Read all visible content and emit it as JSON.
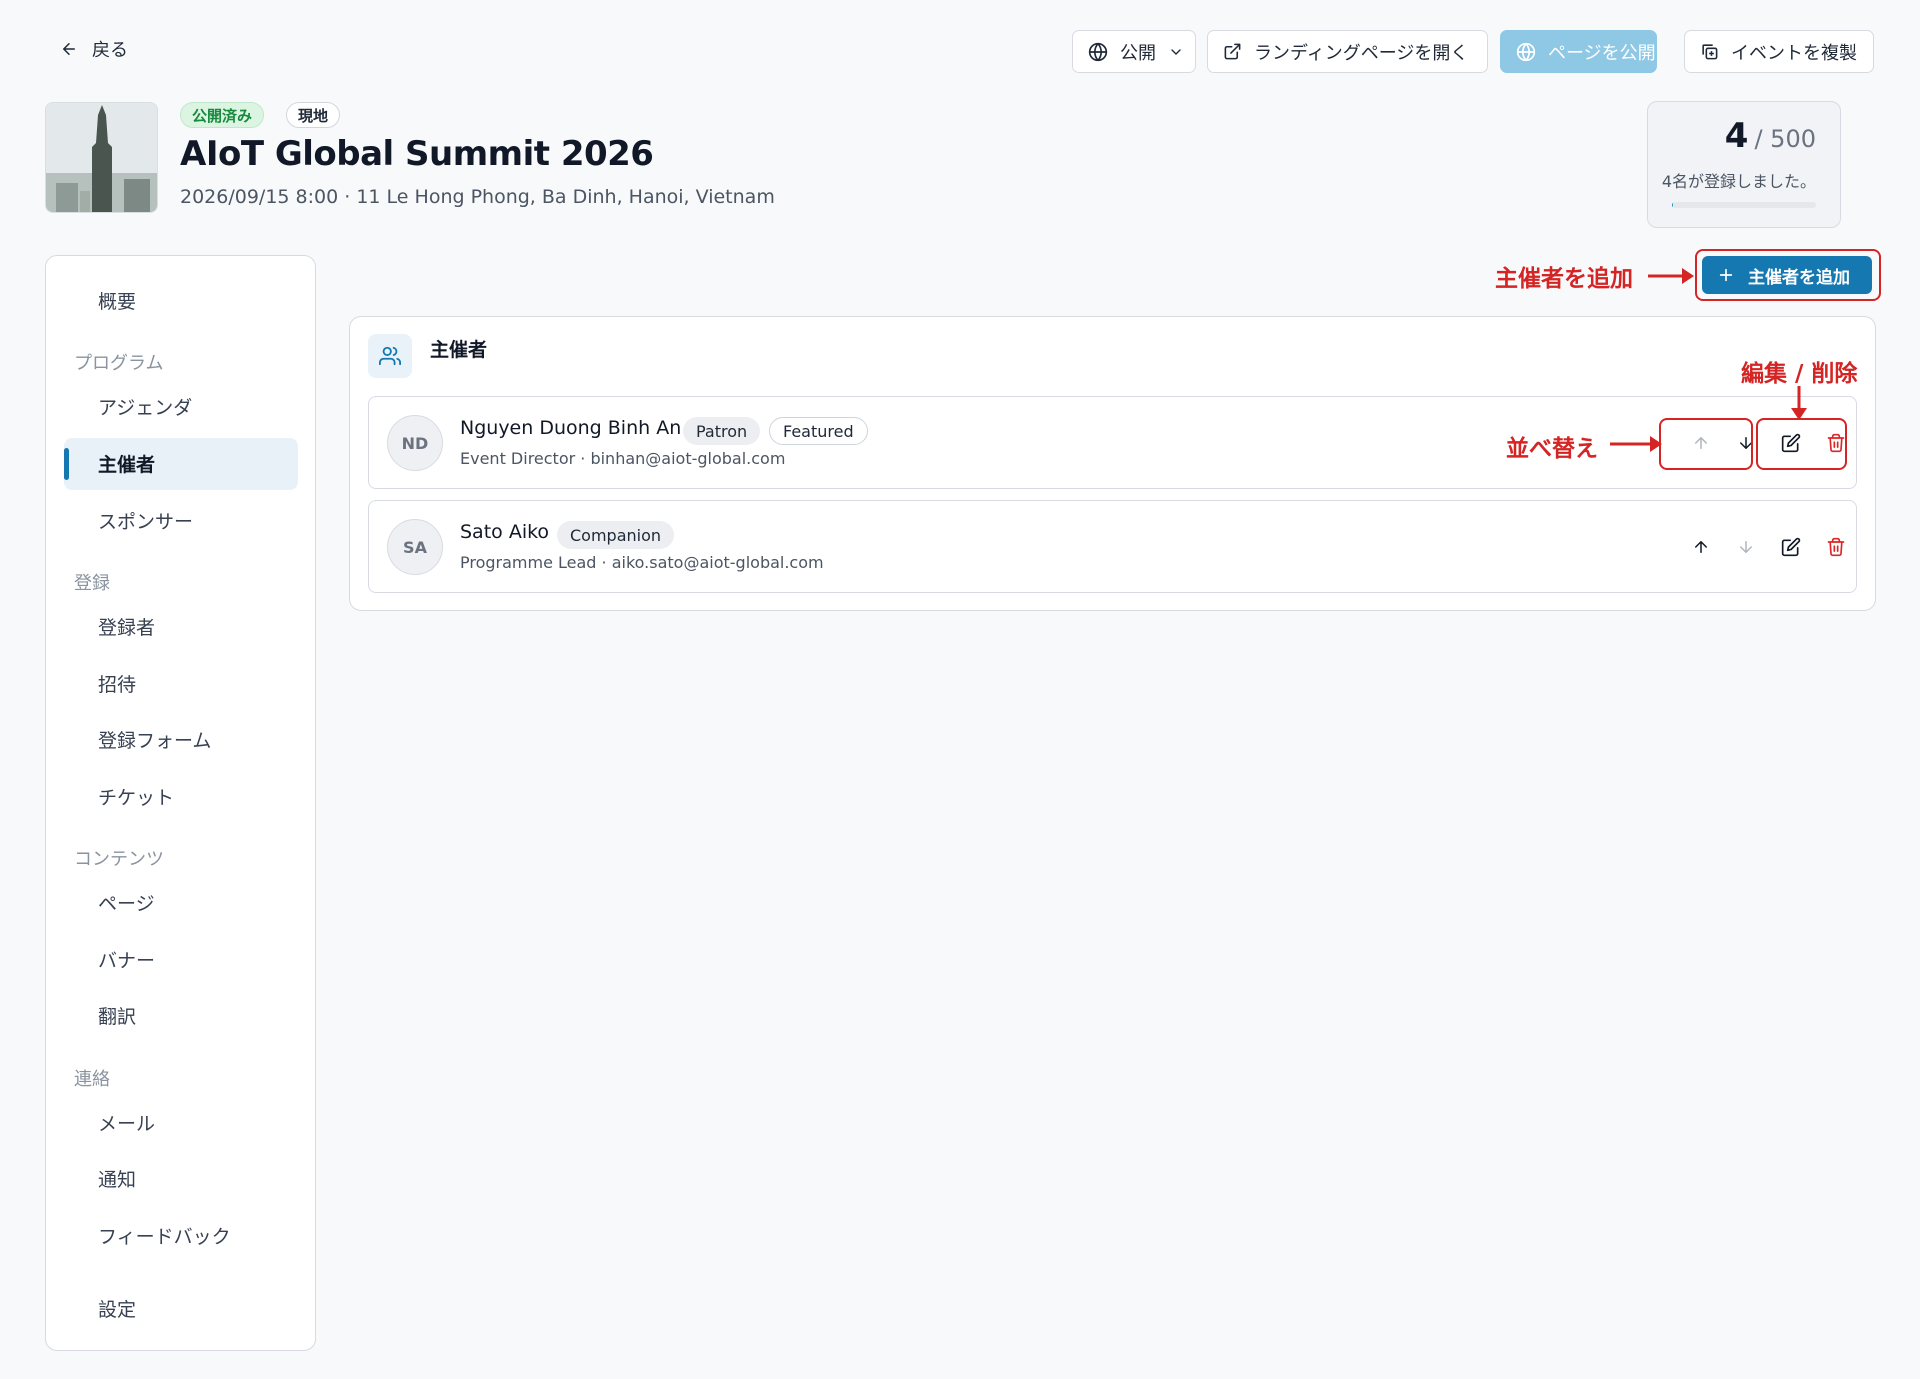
{
  "topbar": {
    "back_label": "戻る",
    "visibility_label": "公開",
    "open_landing_label": "ランディングページを開く",
    "publish_label": "ページを公開",
    "duplicate_label": "イベントを複製"
  },
  "event": {
    "status_badge": "公開済み",
    "type_badge": "現地",
    "title": "AIoT Global Summit 2026",
    "meta": "2026/09/15 8:00 · 11 Le Hong Phong, Ba Dinh, Hanoi, Vietnam"
  },
  "registration": {
    "count": "4",
    "capacity": "/ 500",
    "label": "4名が登録しました。",
    "progress_fraction": 0.008
  },
  "sidebar": {
    "overview": "概要",
    "section_program": "プログラム",
    "agenda": "アジェンダ",
    "organizers": "主催者",
    "sponsors": "スポンサー",
    "section_registration": "登録",
    "registrants": "登録者",
    "invitations": "招待",
    "registration_form": "登録フォーム",
    "tickets": "チケット",
    "section_content": "コンテンツ",
    "pages": "ページ",
    "banners": "バナー",
    "translations": "翻訳",
    "section_contact": "連絡",
    "email": "メール",
    "notifications": "通知",
    "feedback": "フィードバック",
    "settings": "設定"
  },
  "actions": {
    "add_organizer_label": "主催者を追加"
  },
  "organizers_card": {
    "title": "主催者",
    "items": [
      {
        "initials": "ND",
        "name": "Nguyen Duong Binh An",
        "tags": [
          "Patron",
          "Featured"
        ],
        "subtitle": "Event Director · binhan@aiot-global.com"
      },
      {
        "initials": "SA",
        "name": "Sato Aiko",
        "tags": [
          "Companion"
        ],
        "subtitle": "Programme Lead · aiko.sato@aiot-global.com"
      }
    ]
  },
  "annotations": {
    "add_organizer": "主催者を追加",
    "edit_delete": "編集 / 削除",
    "reorder": "並べ替え"
  },
  "colors": {
    "accent": "#1678b0",
    "annotation": "#d42424",
    "published_green": "#178a3d",
    "delete_red": "#dc2626"
  }
}
